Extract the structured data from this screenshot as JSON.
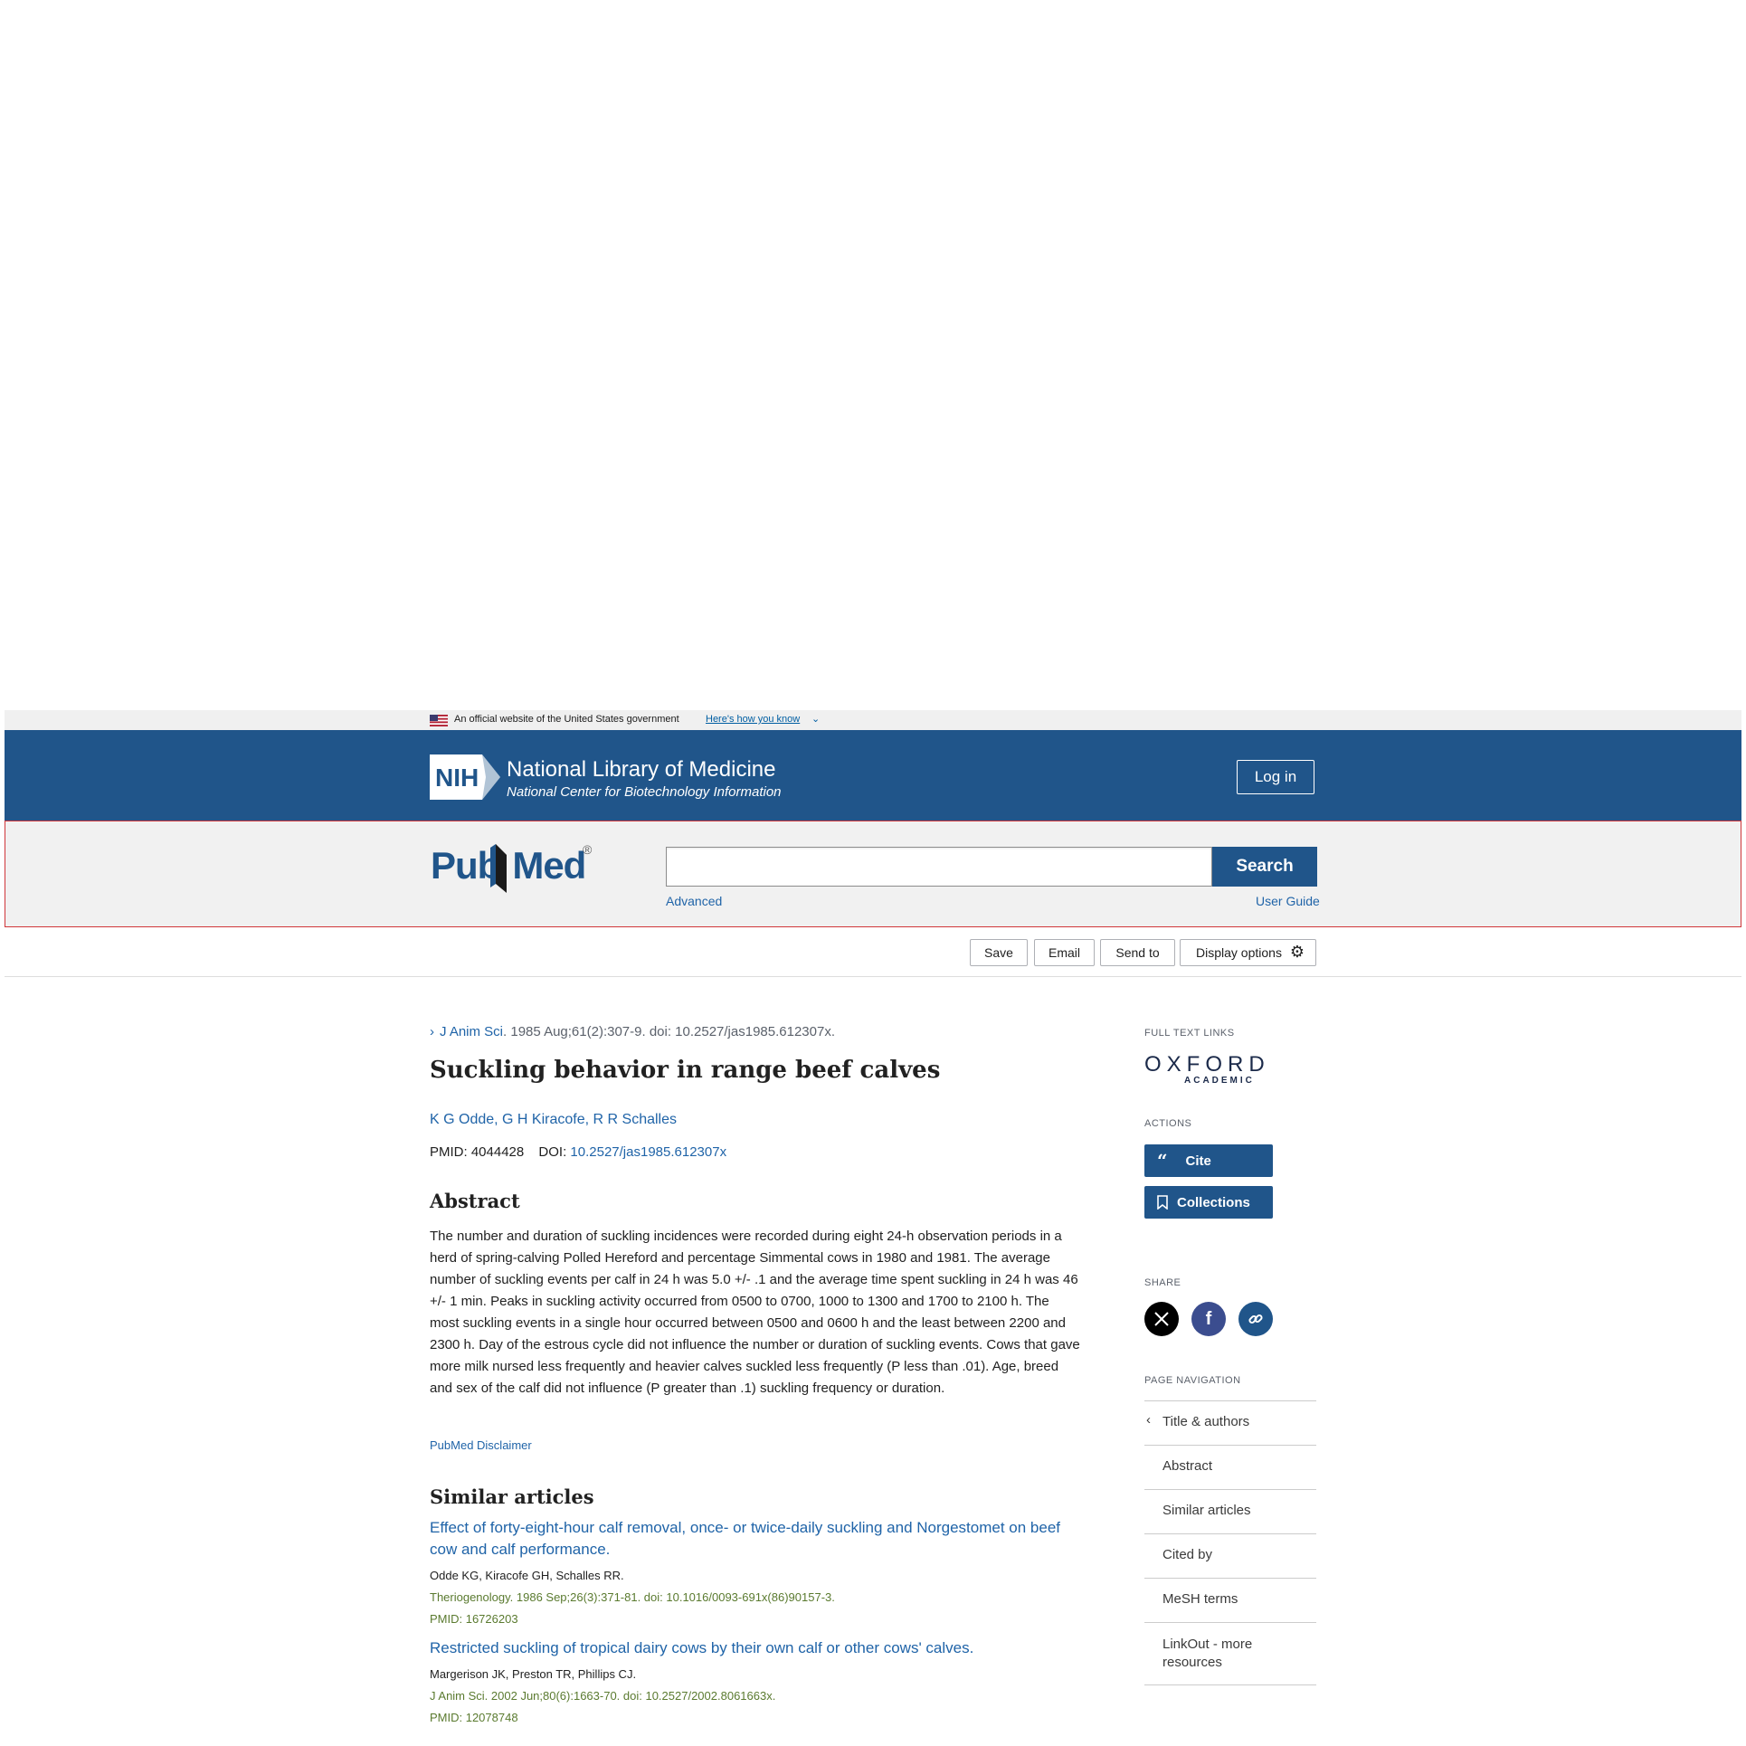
{
  "gov_banner": {
    "text": "An official website of the United States government",
    "link": "Here's how you know"
  },
  "header": {
    "org_title": "National Library of Medicine",
    "org_subtitle": "National Center for Biotechnology Information",
    "login_label": "Log in",
    "logo_text": "NIH"
  },
  "search": {
    "logo_left": "Pub",
    "logo_right": "Med",
    "button_label": "Search",
    "placeholder": "",
    "advanced_label": "Advanced",
    "guide_label": "User Guide"
  },
  "toolbar": {
    "save": "Save",
    "email": "Email",
    "send_to": "Send to",
    "display_options": "Display options"
  },
  "article": {
    "journal": "J Anim Sci",
    "citation": ". 1985 Aug;61(2):307-9. doi: 10.2527/jas1985.612307x.",
    "title": "Suckling behavior in range beef calves",
    "authors": "K G Odde, G H Kiracofe, R R Schalles",
    "pmid_label": "PMID: 4044428",
    "doi_label": "DOI: ",
    "doi_value": "10.2527/jas1985.612307x",
    "abstract_heading": "Abstract",
    "abstract": "The number and duration of suckling incidences were recorded during eight 24-h observation periods in a herd of spring-calving Polled Hereford and percentage Simmental cows in 1980 and 1981. The average number of suckling events per calf in 24 h was 5.0 +/- .1 and the average time spent suckling in 24 h was 46 +/- 1 min. Peaks in suckling activity occurred from 0500 to 0700, 1000 to 1300 and 1700 to 2100 h. The most suckling events in a single hour occurred between 0500 and 0600 h and the least between 2200 and 2300 h. Day of the estrous cycle did not influence the number or duration of suckling events. Cows that gave more milk nursed less frequently and heavier calves suckled less frequently (P less than .01). Age, breed and sex of the calf did not influence (P greater than .1) suckling frequency or duration.",
    "disclaimer": "PubMed Disclaimer",
    "similar_heading": "Similar articles",
    "similar": [
      {
        "title": "Effect of forty-eight-hour calf removal, once- or twice-daily suckling and Norgestomet on beef cow and calf performance.",
        "authors": "Odde KG, Kiracofe GH, Schalles RR.",
        "source": "Theriogenology. 1986 Sep;26(3):371-81. doi: 10.1016/0093-691x(86)90157-3.",
        "pmid": "PMID: 16726203"
      },
      {
        "title": "Restricted suckling of tropical dairy cows by their own calf or other cows' calves.",
        "authors": "Margerison JK, Preston TR, Phillips CJ.",
        "source": "J Anim Sci. 2002 Jun;80(6):1663-70. doi: 10.2527/2002.8061663x.",
        "pmid": "PMID: 12078748"
      }
    ]
  },
  "sidebar": {
    "full_text_heading": "FULL TEXT LINKS",
    "oxford_big": "OXFORD",
    "oxford_small": "ACADEMIC",
    "actions_heading": "ACTIONS",
    "cite_label": "Cite",
    "collections_label": "Collections",
    "share_heading": "SHARE",
    "page_nav_heading": "PAGE NAVIGATION",
    "nav_items": [
      "Title & authors",
      "Abstract",
      "Similar articles",
      "Cited by",
      "MeSH terms",
      "LinkOut - more resources"
    ]
  },
  "colors": {
    "brand_blue": "#20558a",
    "link_blue": "#2064a8",
    "source_green": "#5a7a2f"
  }
}
